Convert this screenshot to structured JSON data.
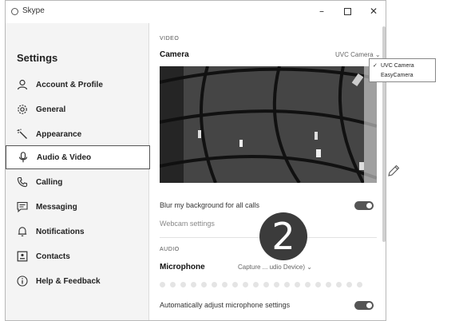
{
  "window": {
    "title": "Skype"
  },
  "sidebar": {
    "title": "Settings",
    "items": [
      {
        "label": "Account & Profile",
        "icon": "person-icon"
      },
      {
        "label": "General",
        "icon": "gear-icon"
      },
      {
        "label": "Appearance",
        "icon": "magic-wand-icon"
      },
      {
        "label": "Audio & Video",
        "icon": "microphone-icon",
        "active": true
      },
      {
        "label": "Calling",
        "icon": "phone-icon"
      },
      {
        "label": "Messaging",
        "icon": "chat-icon"
      },
      {
        "label": "Notifications",
        "icon": "bell-icon"
      },
      {
        "label": "Contacts",
        "icon": "contact-card-icon"
      },
      {
        "label": "Help & Feedback",
        "icon": "info-icon"
      }
    ]
  },
  "video": {
    "section_label": "VIDEO",
    "camera_label": "Camera",
    "camera_value": "UVC Camera",
    "blur_label": "Blur my background for all calls",
    "blur_enabled": true,
    "webcam_link": "Webcam settings"
  },
  "audio": {
    "section_label": "AUDIO",
    "mic_label": "Microphone",
    "mic_value": "Capture ... udio Device)",
    "auto_adjust_label": "Automatically adjust microphone settings",
    "auto_adjust_enabled": true
  },
  "camera_dropdown": {
    "options": [
      {
        "label": "UVC Camera",
        "selected": true
      },
      {
        "label": "EasyCamera",
        "selected": false
      }
    ]
  },
  "step_badge": "2",
  "colors": {
    "toggle_on": "#555555",
    "active_border": "#555555"
  }
}
